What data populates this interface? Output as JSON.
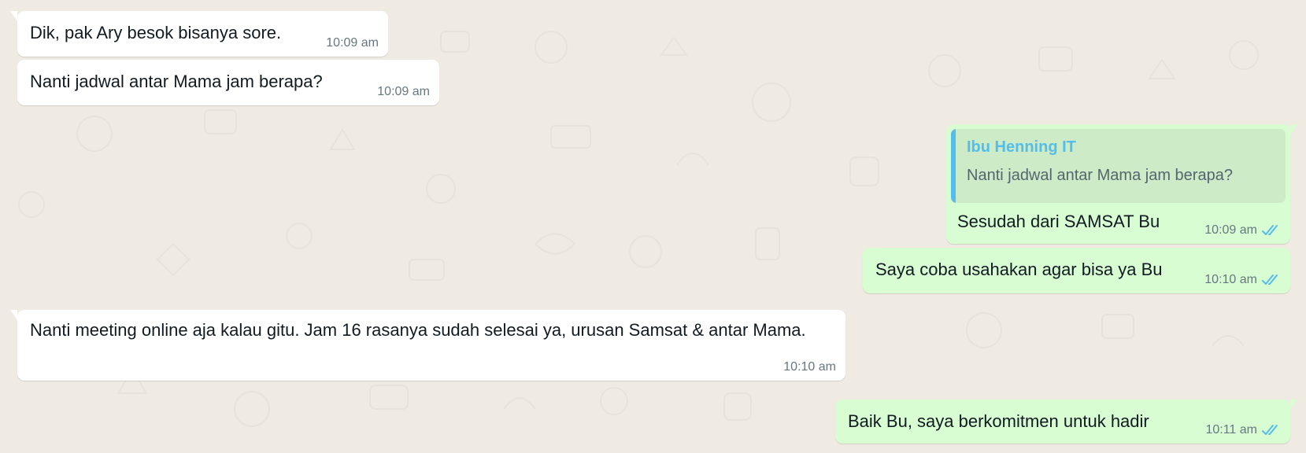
{
  "colors": {
    "background": "#efeae2",
    "incoming_bubble": "#ffffff",
    "outgoing_bubble": "#d9fdd3",
    "quote_background": "#cdebc6",
    "quote_accent": "#53bdeb",
    "timestamp": "#667781",
    "read_ticks": "#53bdeb"
  },
  "messages": [
    {
      "direction": "incoming",
      "text": "Dik, pak Ary besok bisanya sore.",
      "time": "10:09 am"
    },
    {
      "direction": "incoming",
      "text": "Nanti jadwal antar Mama jam berapa?",
      "time": "10:09 am"
    },
    {
      "direction": "outgoing",
      "quote": {
        "author": "Ibu Henning IT",
        "text": "Nanti jadwal antar Mama jam berapa?"
      },
      "text": "Sesudah dari SAMSAT Bu",
      "time": "10:09 am",
      "status_icon": "double-check-read-icon"
    },
    {
      "direction": "outgoing",
      "text": "Saya coba usahakan agar bisa ya Bu",
      "time": "10:10 am",
      "status_icon": "double-check-read-icon"
    },
    {
      "direction": "incoming",
      "text": "Nanti meeting online aja kalau gitu. Jam 16 rasanya sudah selesai ya, urusan Samsat & antar Mama.",
      "time": "10:10 am"
    },
    {
      "direction": "outgoing",
      "text": "Baik Bu, saya berkomitmen untuk hadir",
      "time": "10:11 am",
      "status_icon": "double-check-read-icon"
    }
  ]
}
